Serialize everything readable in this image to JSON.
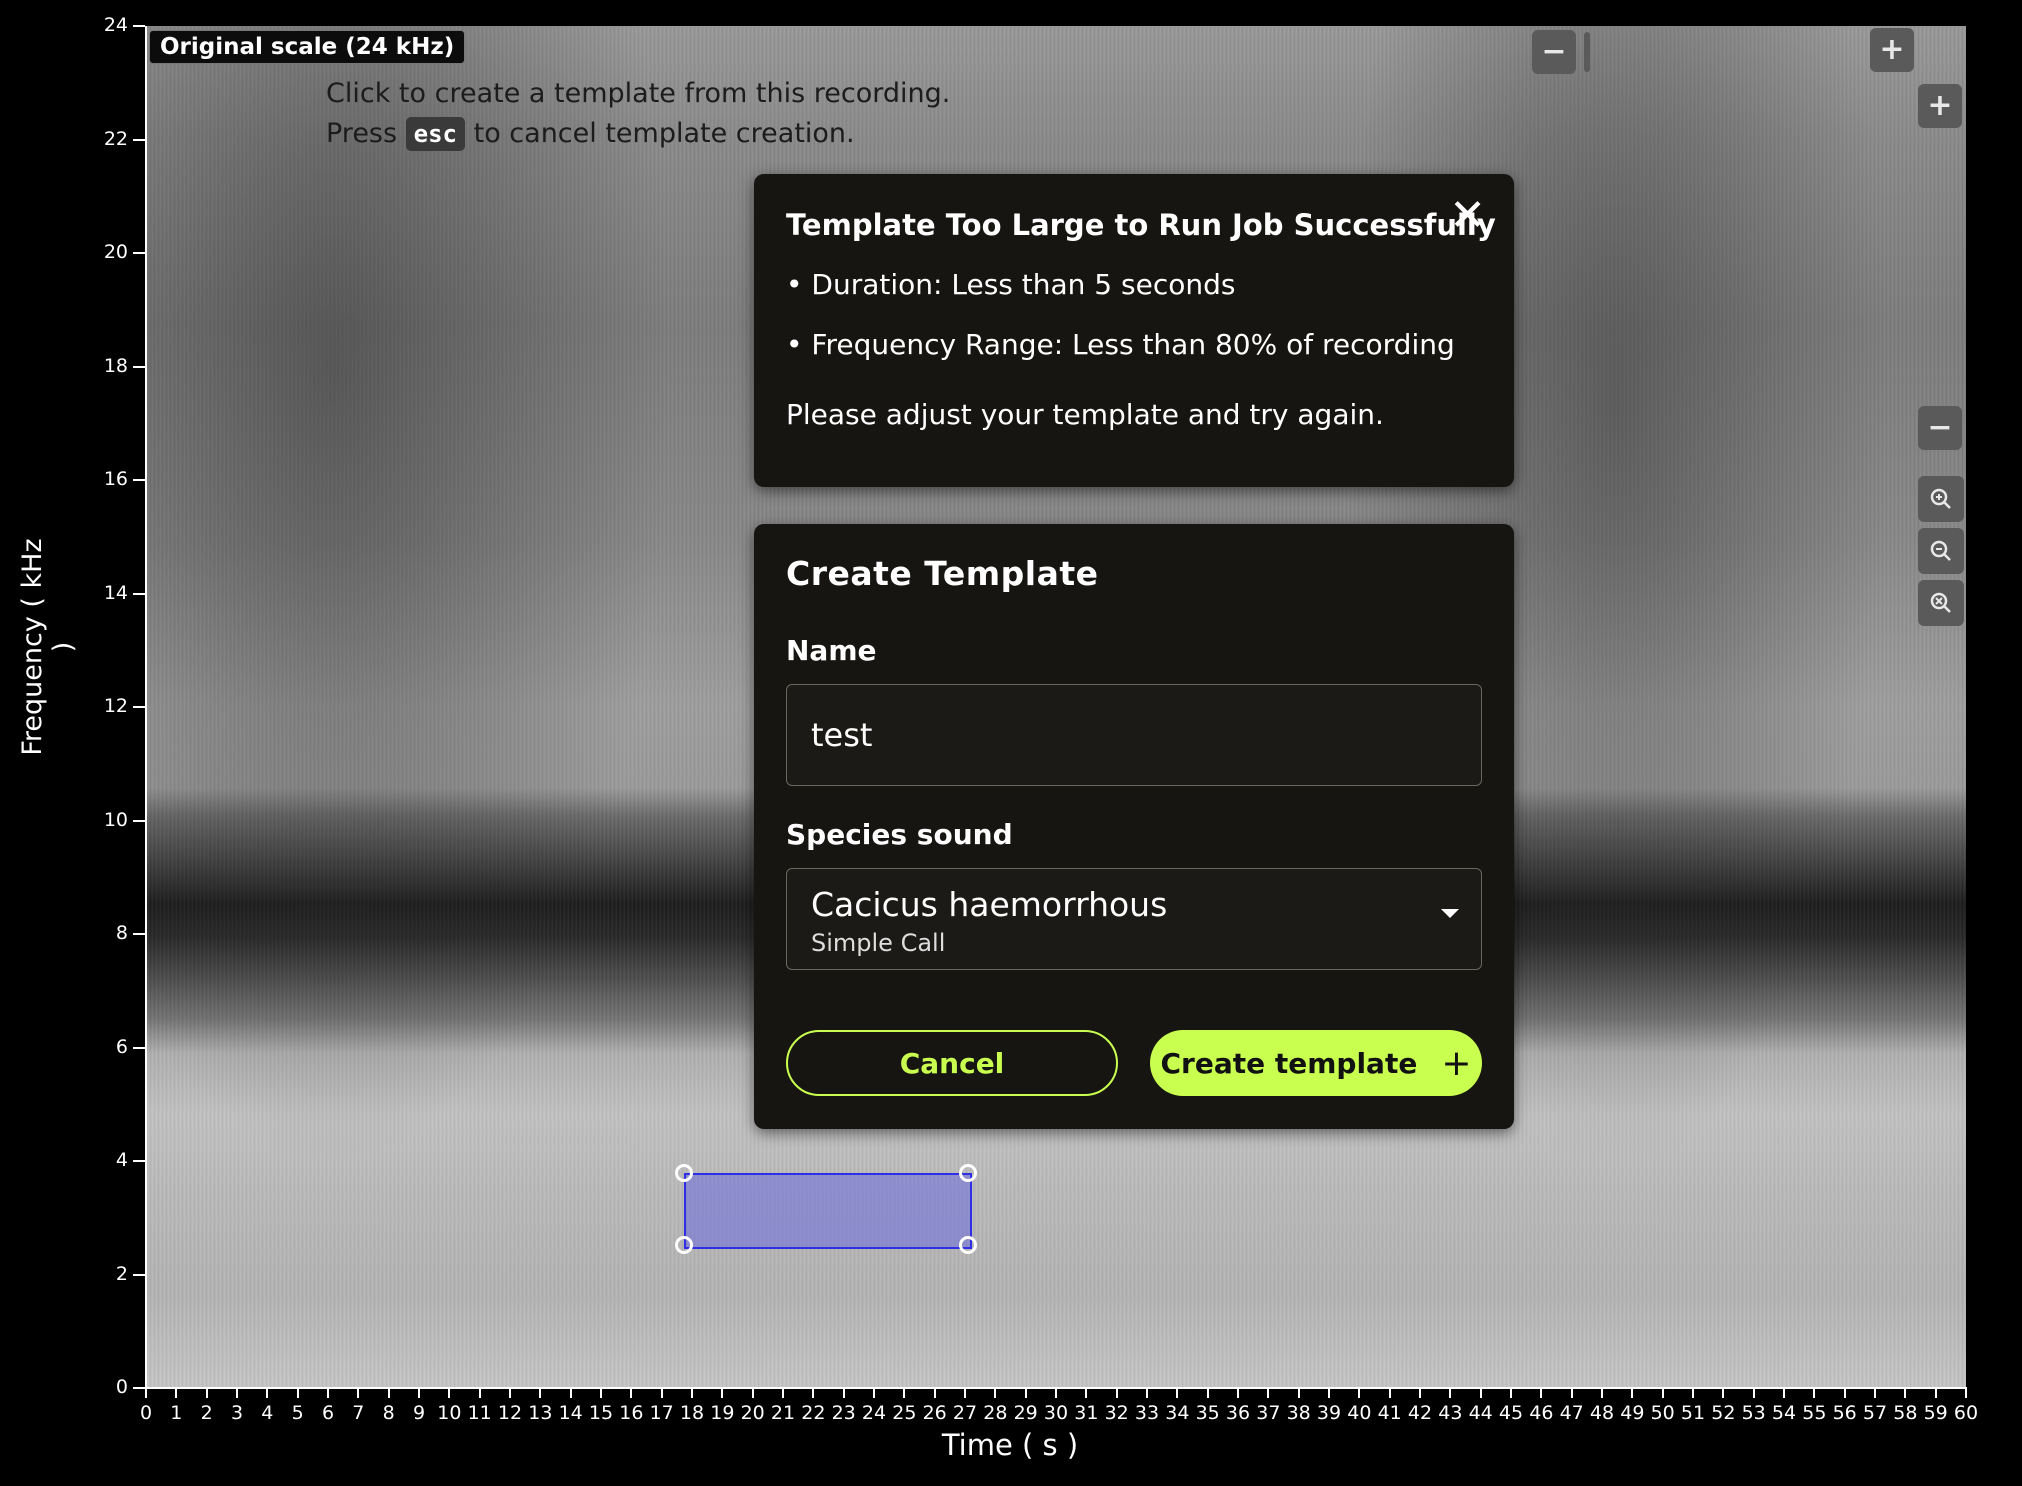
{
  "spectrogram": {
    "scale_badge": "Original scale (24 kHz)",
    "hint_line1": "Click to create a template from this recording.",
    "hint_line2_prefix": "Press",
    "hint_key": "esc",
    "hint_line2_suffix": "to cancel template creation.",
    "y_axis_label": "Frequency ( kHz )",
    "x_axis_label": "Time ( s )",
    "y_ticks": [
      "0",
      "2",
      "4",
      "6",
      "8",
      "10",
      "12",
      "14",
      "16",
      "18",
      "20",
      "22",
      "24"
    ],
    "x_ticks": [
      "0",
      "1",
      "2",
      "3",
      "4",
      "5",
      "6",
      "7",
      "8",
      "9",
      "10",
      "11",
      "12",
      "13",
      "14",
      "15",
      "16",
      "17",
      "18",
      "19",
      "20",
      "21",
      "22",
      "23",
      "24",
      "25",
      "26",
      "27",
      "28",
      "29",
      "30",
      "31",
      "32",
      "33",
      "34",
      "35",
      "36",
      "37",
      "38",
      "39",
      "40",
      "41",
      "42",
      "43",
      "44",
      "45",
      "46",
      "47",
      "48",
      "49",
      "50",
      "51",
      "52",
      "53",
      "54",
      "55",
      "56",
      "57",
      "58",
      "59",
      "60"
    ],
    "selection": {
      "time_start_s": 17.7,
      "time_end_s": 27.2,
      "freq_low_khz": 2.5,
      "freq_high_khz": 3.8
    }
  },
  "toolbar": {
    "zoom_out_time": "−",
    "zoom_in_time": "+",
    "zoom_in_freq": "+",
    "zoom_out_freq": "−"
  },
  "warning": {
    "title": "Template Too Large to Run Job Successfully",
    "close": "✕",
    "bullet1": "• Duration: Less than 5 seconds",
    "bullet2": "• Frequency Range: Less than 80% of recording",
    "message": "Please adjust your template and try again."
  },
  "create_template": {
    "title": "Create Template",
    "name_label": "Name",
    "name_value": "test",
    "species_label": "Species sound",
    "species_primary": "Cacicus haemorrhous",
    "species_secondary": "Simple Call",
    "cancel_label": "Cancel",
    "create_label": "Create template",
    "create_icon": "+"
  },
  "colors": {
    "accent": "#c9ff4f",
    "panel_bg": "#171511",
    "selection": "#2f2fe6"
  }
}
